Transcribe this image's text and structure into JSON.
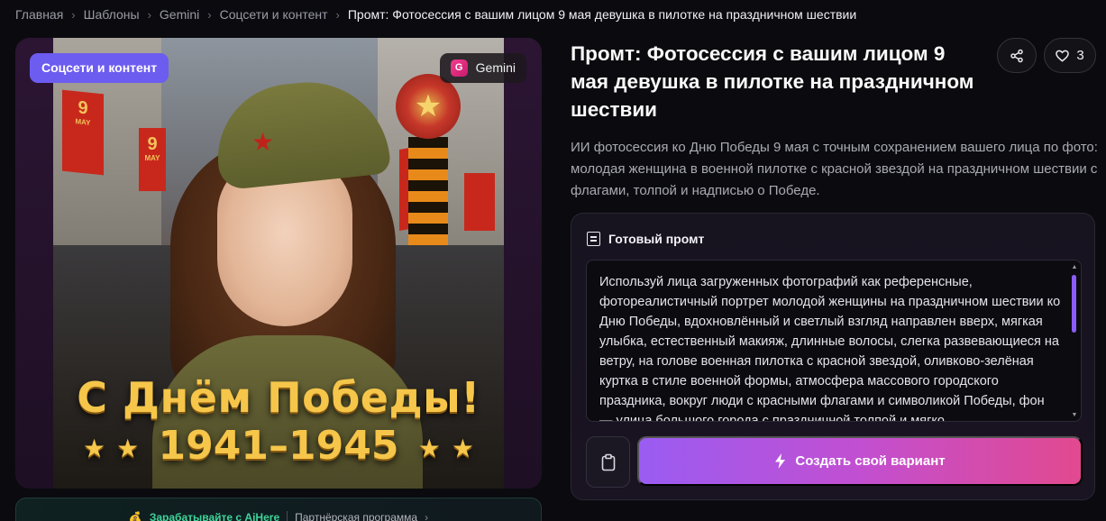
{
  "breadcrumb": {
    "items": [
      "Главная",
      "Шаблоны",
      "Gemini",
      "Соцсети и контент"
    ],
    "current": "Промт: Фотосессия с вашим лицом 9 мая девушка в пилотке на праздничном шествии",
    "separator": "›"
  },
  "image_card": {
    "category_pill": "Соцсети и контент",
    "model_pill": {
      "icon_letter": "G",
      "label": "Gemini",
      "icon": "gemini-icon"
    },
    "artwork": {
      "flag_text": "9",
      "flag_subtext": "MAY",
      "greeting": "С Днём Победы!",
      "years": "1941–1945",
      "star_glyph": "★"
    }
  },
  "affiliate": {
    "emoji": "💰",
    "earn_text": "Зарабатывайте с AiHere",
    "partner_text": "Партнёрская программа",
    "arrow": "›"
  },
  "header": {
    "title": "Промт: Фотосессия с вашим лицом 9 мая девушка в пилотке на праздничном шествии",
    "likes_count": "3"
  },
  "description": "ИИ фотосессия ко Дню Победы 9 мая с точным сохранением вашего лица по фото: молодая женщина в военной пилотке с красной звездой на праздничном шествии с флагами, толпой и надписью о Победе.",
  "prompt_panel": {
    "heading": "Готовый промт",
    "text": "Используй лица загруженных фотографий как референсные, фотореалистичный портрет молодой женщины на праздничном шествии ко Дню Победы, вдохновлённый и светлый взгляд направлен вверх, мягкая улыбка, естественный макияж, длинные волосы, слегка развевающиеся на ветру, на голове военная пилотка с красной звездой, оливково-зелёная куртка в стиле военной формы, атмосфера массового городского праздника, вокруг люди с красными флагами и символикой Победы, фон — улица большого города с праздничной толпой и мягко",
    "create_button": "Создать свой вариант"
  },
  "colors": {
    "accent_purple": "#6d5cf0",
    "gradient_start": "#9a5cf2",
    "gradient_end": "#e2498f",
    "earn_green": "#3ed59a"
  }
}
